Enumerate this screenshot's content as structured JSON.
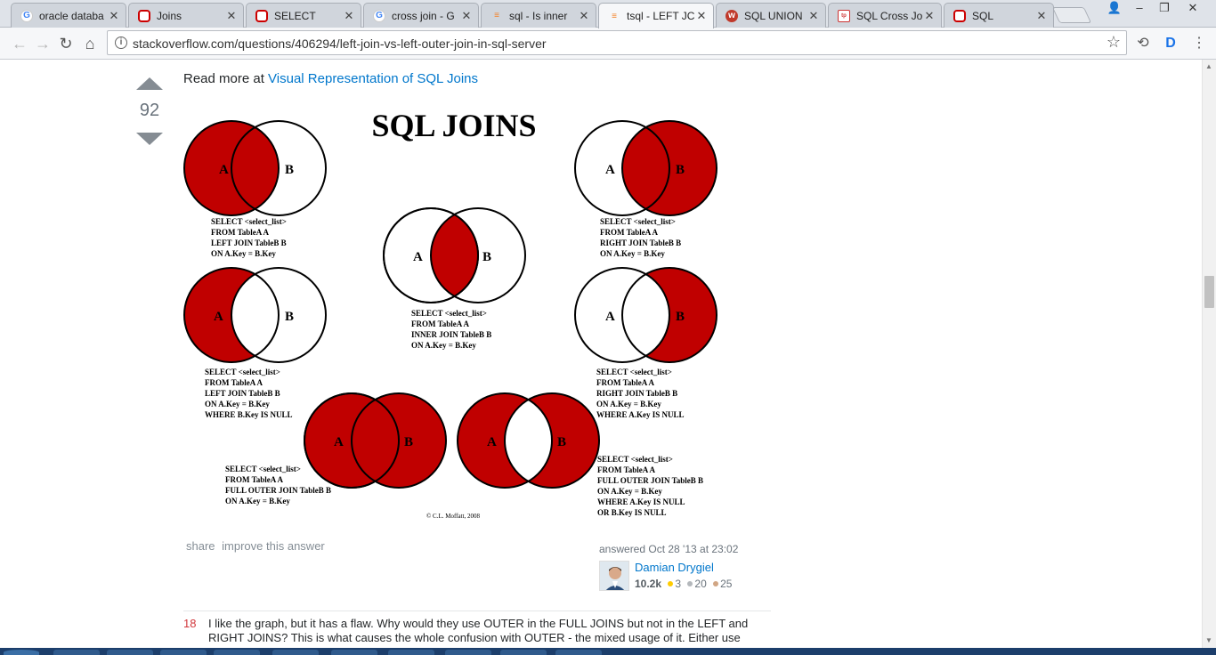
{
  "browser": {
    "tabs": [
      {
        "title": "oracle databa",
        "icon": "google-icon",
        "active": false
      },
      {
        "title": "Joins",
        "icon": "oracle-icon",
        "active": false
      },
      {
        "title": "SELECT",
        "icon": "oracle-icon",
        "active": false
      },
      {
        "title": "cross join - G",
        "icon": "google-icon",
        "active": false
      },
      {
        "title": "sql - Is inner",
        "icon": "stackoverflow-icon",
        "active": false
      },
      {
        "title": "tsql - LEFT JC",
        "icon": "stackoverflow-icon",
        "active": true
      },
      {
        "title": "SQL UNION",
        "icon": "w3schools-icon",
        "active": false
      },
      {
        "title": "SQL Cross Jo",
        "icon": "tutorial-icon",
        "active": false
      },
      {
        "title": "SQL",
        "icon": "oracle-icon",
        "active": false
      }
    ],
    "url": "stackoverflow.com/questions/406294/left-join-vs-left-outer-join-in-sql-server"
  },
  "answer": {
    "vote_count": "92",
    "read_more_prefix": "Read more at ",
    "read_more_link": "Visual Representation of SQL Joins",
    "image": {
      "title": "SQL JOINS",
      "circle_a": "A",
      "circle_b": "B",
      "credit": "© C.L. Moffatt, 2008",
      "queries": {
        "left_join": [
          "SELECT <select_list>",
          "FROM TableA A",
          "LEFT JOIN TableB B",
          "ON A.Key = B.Key"
        ],
        "right_join": [
          "SELECT <select_list>",
          "FROM TableA A",
          "RIGHT JOIN TableB B",
          "ON A.Key = B.Key"
        ],
        "inner_join": [
          "SELECT <select_list>",
          "FROM TableA A",
          "INNER JOIN TableB B",
          "ON A.Key = B.Key"
        ],
        "left_excl": [
          "SELECT <select_list>",
          "FROM TableA A",
          "LEFT JOIN TableB B",
          "ON A.Key = B.Key",
          "WHERE B.Key IS NULL"
        ],
        "right_excl": [
          "SELECT <select_list>",
          "FROM TableA A",
          "RIGHT JOIN TableB B",
          "ON A.Key = B.Key",
          "WHERE A.Key IS NULL"
        ],
        "full_outer": [
          "SELECT <select_list>",
          "FROM TableA A",
          "FULL OUTER JOIN TableB B",
          "ON A.Key = B.Key"
        ],
        "full_outer_excl": [
          "SELECT <select_list>",
          "FROM TableA A",
          "FULL OUTER JOIN TableB B",
          "ON A.Key = B.Key",
          "WHERE A.Key IS NULL",
          "OR B.Key IS NULL"
        ]
      }
    },
    "share_label": "share",
    "improve_label": "improve this answer",
    "answered_text": "answered Oct 28 '13 at 23:02",
    "user": {
      "name": "Damian Drygiel",
      "reputation": "10.2k",
      "gold": "3",
      "silver": "20",
      "bronze": "25"
    }
  },
  "comment": {
    "score": "18",
    "text": "I like the graph, but it has a flaw. Why would they use OUTER in the FULL JOINS but not in the LEFT and RIGHT JOINS? This is what causes the whole confusion with OUTER - the mixed usage of it. Either use"
  },
  "colors": {
    "venn_fill": "#c00000",
    "link": "#0077cc",
    "comment_score": "#d1383d"
  }
}
